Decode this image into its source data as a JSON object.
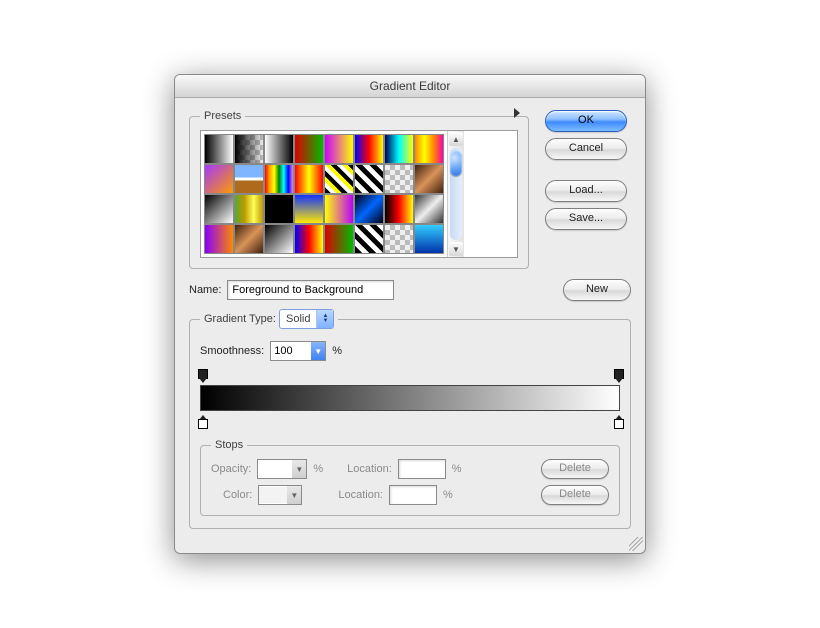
{
  "window": {
    "title": "Gradient Editor"
  },
  "buttons": {
    "ok": "OK",
    "cancel": "Cancel",
    "load": "Load...",
    "save": "Save...",
    "new": "New",
    "delete": "Delete"
  },
  "presets": {
    "legend": "Presets"
  },
  "name": {
    "label": "Name:",
    "value": "Foreground to Background"
  },
  "gradient_type": {
    "label": "Gradient Type:",
    "value": "Solid"
  },
  "smoothness": {
    "label": "Smoothness:",
    "value": "100",
    "unit": "%"
  },
  "stops": {
    "legend": "Stops",
    "opacity_label": "Opacity:",
    "color_label": "Color:",
    "location_label": "Location:",
    "unit": "%"
  }
}
